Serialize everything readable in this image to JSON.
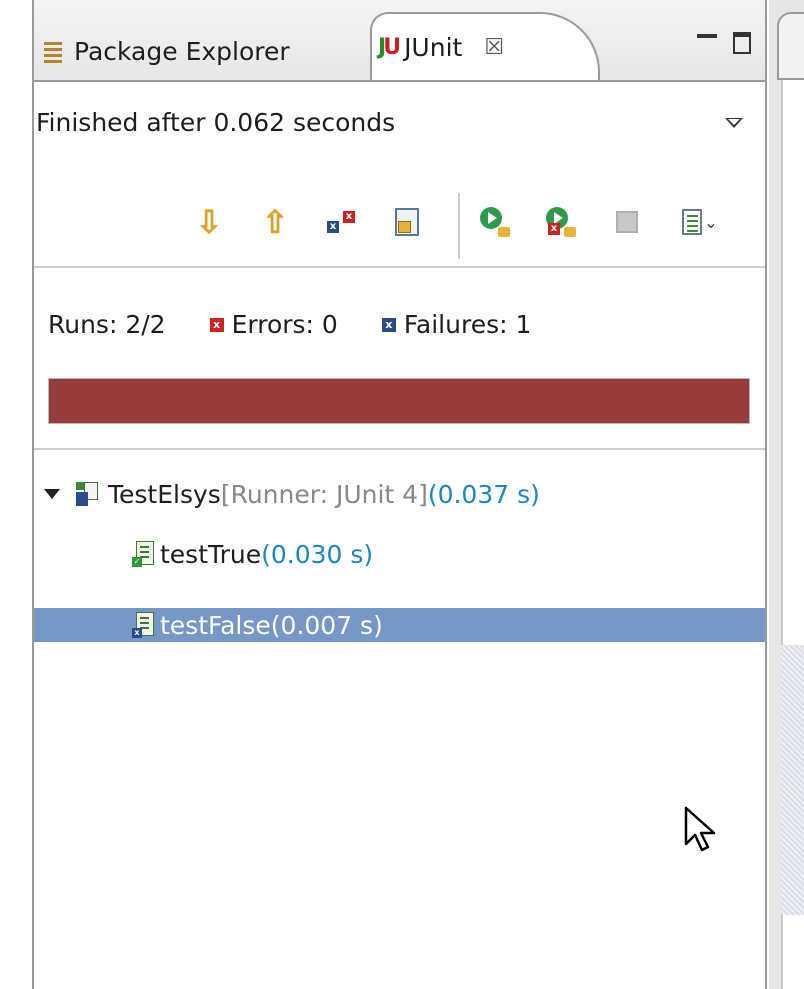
{
  "tabs": {
    "package_explorer": "Package Explorer",
    "junit": "JUnit",
    "close_glyph": "☒"
  },
  "status": {
    "finished": "Finished after 0.062 seconds"
  },
  "counters": {
    "runs_label": "Runs: ",
    "runs_value": "2/2",
    "errors_label": "Errors: ",
    "errors_value": "0",
    "failures_label": "Failures: ",
    "failures_value": "1"
  },
  "progress": {
    "fraction": 1.0,
    "color": "#983b3b",
    "state": "failed"
  },
  "tree": {
    "suite": {
      "name": "TestElsys",
      "runner": " [Runner: JUnit 4]",
      "time": " (0.037 s)",
      "expanded": true
    },
    "tests": [
      {
        "name": "testTrue",
        "time": " (0.030 s)",
        "result": "pass",
        "selected": false
      },
      {
        "name": "testFalse",
        "time": " (0.007 s)",
        "result": "failure",
        "selected": true
      }
    ]
  },
  "toolbar": {
    "icons": [
      "next-failure-icon",
      "previous-failure-icon",
      "show-failures-only-icon",
      "scroll-lock-icon",
      "rerun-test-icon",
      "rerun-failed-first-icon",
      "stop-icon",
      "test-run-history-icon"
    ]
  },
  "colors": {
    "selection": "#7598c8",
    "time_text": "#1c85c7",
    "error_red": "#cc2222",
    "failure_blue": "#2a4d8a"
  }
}
